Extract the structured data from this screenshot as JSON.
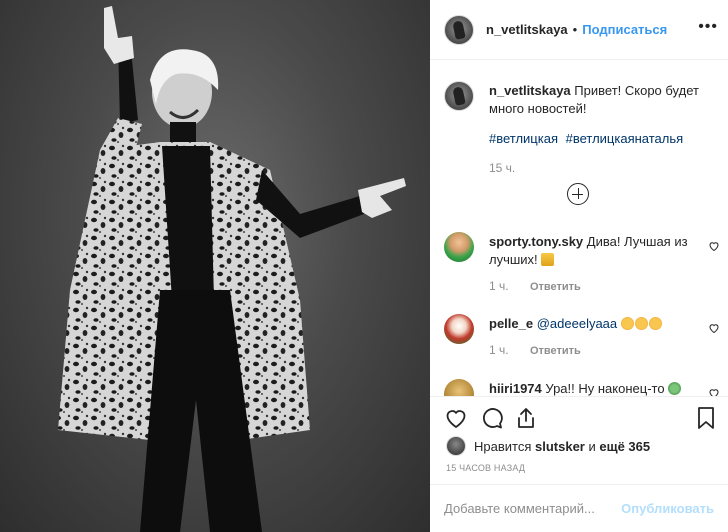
{
  "header": {
    "username": "n_vetlitskaya",
    "separator": "•",
    "follow_label": "Подписаться",
    "more_label": "•••"
  },
  "caption": {
    "username": "n_vetlitskaya",
    "text": "Привет! Скоро будет много новостей!",
    "hashtags": [
      "#ветлицкая",
      "#ветлицкаянаталья"
    ],
    "time": "15 ч."
  },
  "comments": [
    {
      "username": "sporty.tony.sky",
      "text": "Дива! Лучшая из лучших!",
      "emoji": "crown",
      "time": "1 ч.",
      "reply_label": "Ответить"
    },
    {
      "username": "pelle_e",
      "mention": "@adeeelyaaa",
      "emoji": "heart-eyes x3",
      "time": "1 ч.",
      "reply_label": "Ответить"
    },
    {
      "username": "hiiri1974",
      "text": "Ура!! Ну наконец-то",
      "emoji": "clover"
    }
  ],
  "likes": {
    "prefix": "Нравится",
    "user": "slutsker",
    "middle": "и",
    "count_text": "ещё 365"
  },
  "post_time": "15 ЧАСОВ НАЗАД",
  "add_comment": {
    "placeholder": "Добавьте комментарий...",
    "publish_label": "Опубликовать"
  },
  "colors": {
    "link_blue": "#3897f0",
    "hashtag_blue": "#003569",
    "muted_gray": "#8e8e8e",
    "publish_disabled": "#b2dffc",
    "text": "#262626"
  },
  "icons": [
    "heart-icon",
    "comment-icon",
    "share-icon",
    "bookmark-icon",
    "load-more-plus-icon",
    "more-dots-icon"
  ]
}
